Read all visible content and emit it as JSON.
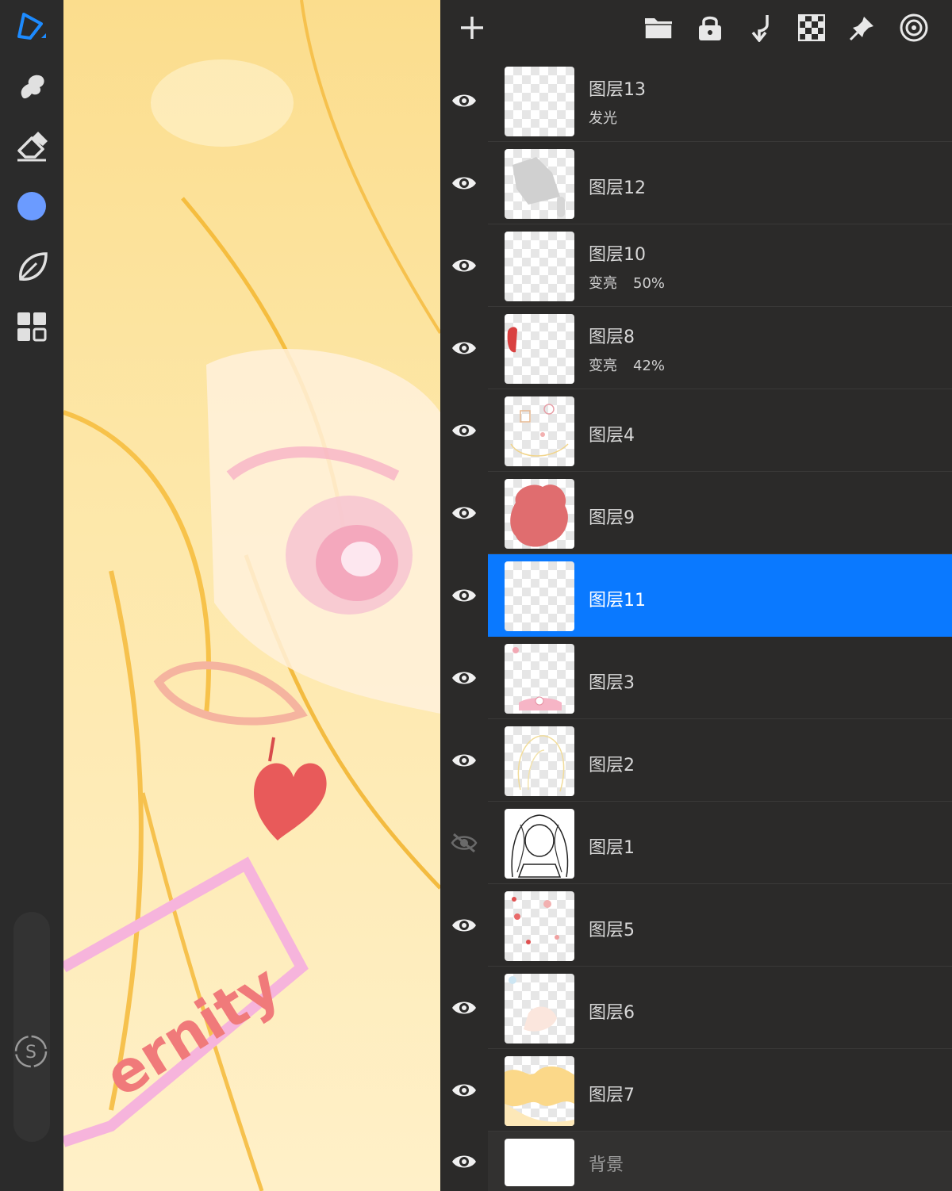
{
  "colors": {
    "accent": "#0a79ff",
    "current_color": "#6b9bff",
    "panel_bg": "#2b2a29",
    "toolbar_bg": "#2b2b2b"
  },
  "canvas": {
    "artwork_text": "ernity"
  },
  "left_toolbar": {
    "tools": [
      "brush-logo-icon",
      "smudge-icon",
      "eraser-icon",
      "color-swatch",
      "leaf-icon",
      "layers-grid-icon"
    ],
    "s_button_label": "S"
  },
  "layers_panel": {
    "toolbar_icons": [
      "add-icon",
      "folder-icon",
      "lock-icon",
      "merge-down-icon",
      "checkerboard-icon",
      "pin-icon",
      "target-icon"
    ],
    "layers": [
      {
        "name": "图层13",
        "blend": "发光",
        "opacity": "",
        "visible": true
      },
      {
        "name": "图层12",
        "blend": "",
        "opacity": "",
        "visible": true
      },
      {
        "name": "图层10",
        "blend": "变亮",
        "opacity": "50%",
        "visible": true
      },
      {
        "name": "图层8",
        "blend": "变亮",
        "opacity": "42%",
        "visible": true
      },
      {
        "name": "图层4",
        "blend": "",
        "opacity": "",
        "visible": true
      },
      {
        "name": "图层9",
        "blend": "",
        "opacity": "",
        "visible": true
      },
      {
        "name": "图层11",
        "blend": "",
        "opacity": "",
        "visible": true,
        "selected": true
      },
      {
        "name": "图层3",
        "blend": "",
        "opacity": "",
        "visible": true
      },
      {
        "name": "图层2",
        "blend": "",
        "opacity": "",
        "visible": true
      },
      {
        "name": "图层1",
        "blend": "",
        "opacity": "",
        "visible": false
      },
      {
        "name": "图层5",
        "blend": "",
        "opacity": "",
        "visible": true
      },
      {
        "name": "图层6",
        "blend": "",
        "opacity": "",
        "visible": true
      },
      {
        "name": "图层7",
        "blend": "",
        "opacity": "",
        "visible": true
      },
      {
        "name": "背景",
        "blend": "",
        "opacity": "",
        "visible": true
      }
    ]
  }
}
